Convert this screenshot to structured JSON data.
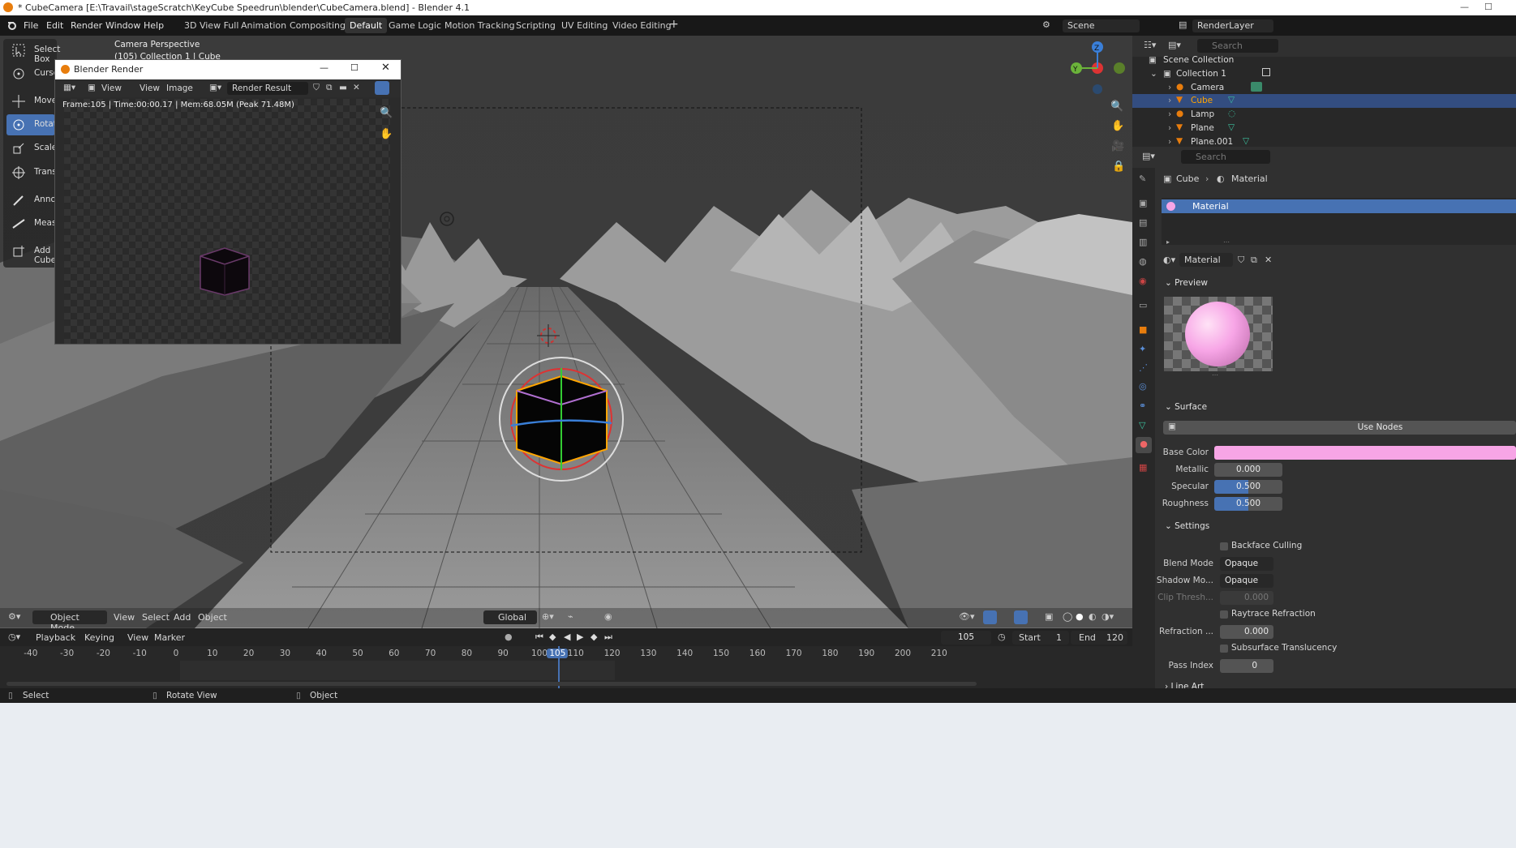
{
  "app": {
    "title": "* CubeCamera [E:\\Travail\\stageScratch\\KeyCube Speedrun\\blender\\CubeCamera.blend] - Blender 4.1"
  },
  "menu": [
    "File",
    "Edit",
    "Render",
    "Window",
    "Help"
  ],
  "workspaces": [
    "3D View Full",
    "Animation",
    "Compositing",
    "Default",
    "Game Logic",
    "Motion Tracking",
    "Scripting",
    "UV Editing",
    "Video Editing"
  ],
  "header_right": {
    "scene": "Scene",
    "view_layer": "RenderLayer",
    "search_placeholder": "Search"
  },
  "viewport": {
    "overlay_title": "Camera Perspective",
    "overlay_sub": "(105) Collection 1 | Cube"
  },
  "tools": [
    {
      "label": "Select Box"
    },
    {
      "label": "Cursor"
    },
    {
      "label": "Move"
    },
    {
      "label": "Rotate"
    },
    {
      "label": "Scale"
    },
    {
      "label": "Transform"
    },
    {
      "label": "Annotate"
    },
    {
      "label": "Measure"
    },
    {
      "label": "Add Cube"
    }
  ],
  "render_window": {
    "title": "Blender Render",
    "menu_view": "View",
    "menu_view2": "View",
    "menu_image": "Image",
    "slot": "Render Result",
    "info": "Frame:105 | Time:00:00.17 | Mem:68.05M (Peak 71.48M)"
  },
  "outliner": {
    "root": "Scene Collection",
    "collection": "Collection 1",
    "items": [
      "Camera",
      "Cube",
      "Lamp",
      "Plane",
      "Plane.001"
    ],
    "selected": "Cube"
  },
  "properties": {
    "search_placeholder": "Search",
    "breadcrumb_object": "Cube",
    "breadcrumb_material": "Material",
    "slot": "Material",
    "material_name": "Material",
    "preview_label": "Preview",
    "surface_label": "Surface",
    "use_nodes": "Use Nodes",
    "base_color_label": "Base Color",
    "base_color": "#f7a5e6",
    "metallic_label": "Metallic",
    "metallic": "0.000",
    "specular_label": "Specular",
    "specular": "0.500",
    "roughness_label": "Roughness",
    "roughness": "0.500",
    "settings_label": "Settings",
    "backface": "Backface Culling",
    "blend_mode_label": "Blend Mode",
    "blend_mode": "Opaque",
    "shadow_mode_label": "Shadow Mo...",
    "shadow_mode": "Opaque",
    "clip_label": "Clip Thresh...",
    "clip": "0.000",
    "raytrace": "Raytrace Refraction",
    "refraction_label": "Refraction ...",
    "refraction": "0.000",
    "subsurface": "Subsurface Translucency",
    "pass_index_label": "Pass Index",
    "pass_index": "0",
    "line_art": "Line Art"
  },
  "viewport_header": {
    "mode": "Object Mode",
    "menu": [
      "View",
      "Select",
      "Add",
      "Object"
    ],
    "orientation": "Global"
  },
  "timeline": {
    "menu": [
      "Playback",
      "Keying",
      "View",
      "Marker"
    ],
    "current_frame": "105",
    "start_label": "Start",
    "start": "1",
    "end_label": "End",
    "end": "120",
    "ticks": [
      "-40",
      "-30",
      "-20",
      "-10",
      "0",
      "10",
      "20",
      "30",
      "40",
      "50",
      "60",
      "70",
      "80",
      "90",
      "100",
      "105",
      "110",
      "120",
      "130",
      "140",
      "150",
      "160",
      "170",
      "180",
      "190",
      "200",
      "210"
    ]
  },
  "status": {
    "select": "Select",
    "rotate": "Rotate View",
    "object": "Object"
  },
  "colors": {
    "accent": "#4772b3",
    "selection": "#334d80",
    "base_color": "#f7a5e6",
    "active_orange": "#ffa500"
  }
}
